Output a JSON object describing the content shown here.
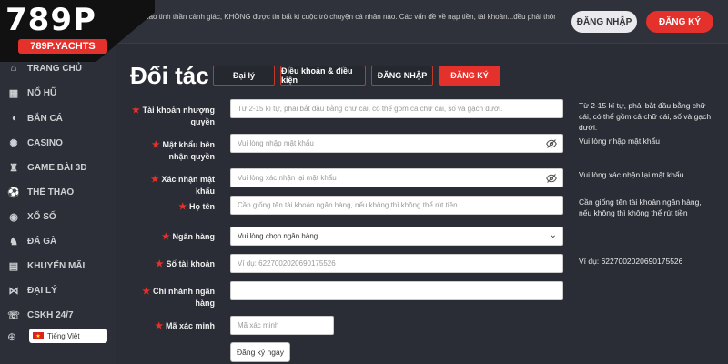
{
  "header": {
    "marquee": "văng cao tinh thần cảnh giác, KHÔNG được tin bất kì cuộc trò chuyện cá nhân nào. Các vấn đề về nạp tiền, tài khoản...đều phải thông qua C",
    "login_label": "ĐĂNG NHẬP",
    "register_label": "ĐĂNG KÝ"
  },
  "logo": {
    "main": "789P",
    "sub": "789P.YACHTS"
  },
  "sidebar": {
    "items": [
      {
        "label": "TRANG CHỦ",
        "icon": "home-icon"
      },
      {
        "label": "NỔ HŨ",
        "icon": "slot-icon"
      },
      {
        "label": "BẮN CÁ",
        "icon": "fish-icon"
      },
      {
        "label": "CASINO",
        "icon": "chip-icon"
      },
      {
        "label": "GAME BÀI 3D",
        "icon": "chess-icon"
      },
      {
        "label": "THỂ THAO",
        "icon": "soccer-icon"
      },
      {
        "label": "XỔ SỐ",
        "icon": "lottery-icon"
      },
      {
        "label": "ĐÁ GÀ",
        "icon": "rooster-icon"
      },
      {
        "label": "KHUYẾN MÃI",
        "icon": "gift-icon"
      },
      {
        "label": "ĐẠI LÝ",
        "icon": "handshake-icon"
      },
      {
        "label": "CSKH 24/7",
        "icon": "support-icon"
      }
    ],
    "language": "Tiếng Việt"
  },
  "main": {
    "title": "Đối tác",
    "tabs": [
      {
        "label": "Đại lý"
      },
      {
        "label": "Điều khoản & điều kiện"
      },
      {
        "label": "ĐĂNG NHẬP"
      },
      {
        "label": "ĐĂNG KÝ"
      }
    ],
    "form": {
      "username": {
        "label": "Tài khoản nhượng quyền",
        "placeholder": "Từ 2-15 kí tự, phải bắt đầu bằng chữ cái, có thể  gồm cả chữ cái, số và gạch dưới.",
        "hint": "Từ 2-15 kí tự, phải bắt đầu bằng chữ cái, có thể gồm cả chữ cái, số và gạch dưới."
      },
      "password": {
        "label": "Mật khẩu bên nhận quyền",
        "placeholder": "Vui lòng nhập mật khẩu",
        "hint": "Vui lòng nhập mật khẩu"
      },
      "confirm": {
        "label": "Xác nhận mật khẩu",
        "placeholder": "Vui lòng xác nhận lại mật khẩu",
        "hint": "Vui lòng xác nhận lại mật khẩu"
      },
      "fullname": {
        "label": "Họ tên",
        "placeholder": "Cần giống tên tài khoản ngân hàng, nếu không thì không thể rút tiền",
        "hint": "Cần giống tên tài khoản ngân hàng, nếu không thì không thể rút tiền"
      },
      "bank": {
        "label": "Ngân hàng",
        "value": "Vui lòng chọn ngân hàng"
      },
      "account_number": {
        "label": "Số tài khoản",
        "placeholder": "Ví dụ:  6227002020690175526",
        "hint": "Ví dụ:   6227002020690175526"
      },
      "branch": {
        "label": "Chi nhánh ngân hàng",
        "placeholder": ""
      },
      "verify": {
        "label": "Mã xác minh",
        "placeholder": "Mã xác minh"
      },
      "submit_label": "Đăng ký ngay"
    }
  },
  "colors": {
    "accent": "#e5312b",
    "background": "#2a2d35"
  }
}
